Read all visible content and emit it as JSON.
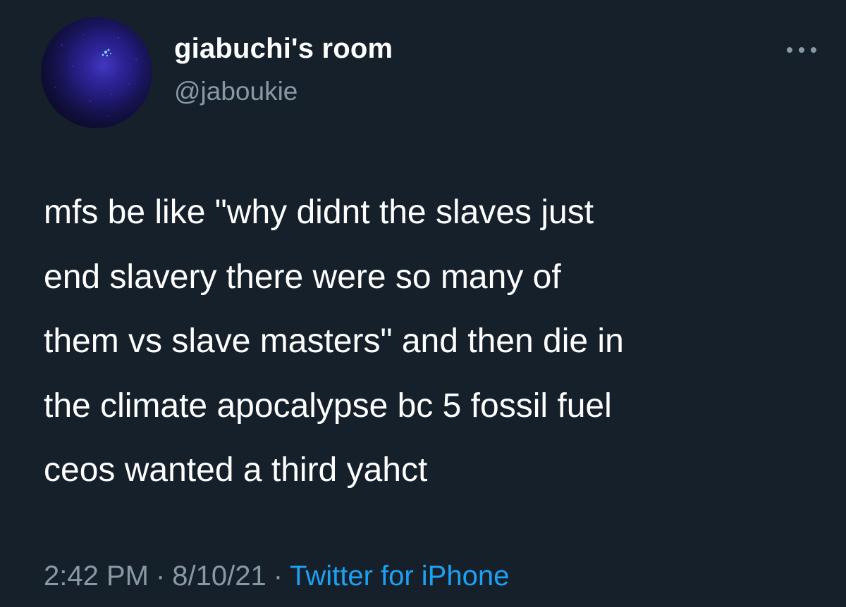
{
  "author": {
    "display_name": "giabuchi's room",
    "handle": "@jaboukie"
  },
  "tweet": {
    "lines": [
      "mfs be like \"why didnt the slaves just",
      "end slavery there were so many of",
      "them vs slave masters\" and then die in",
      "the climate apocalypse bc 5 fossil fuel",
      "ceos wanted a third yahct"
    ],
    "time": "2:42 PM",
    "date": "8/10/21",
    "separator": "·",
    "source": "Twitter for iPhone"
  },
  "icons": {
    "more": "more-options-icon",
    "avatar": "profile-avatar"
  },
  "colors": {
    "background": "#15202b",
    "primary_text": "#ffffff",
    "secondary_text": "#8899a6",
    "accent": "#1da1f2"
  }
}
